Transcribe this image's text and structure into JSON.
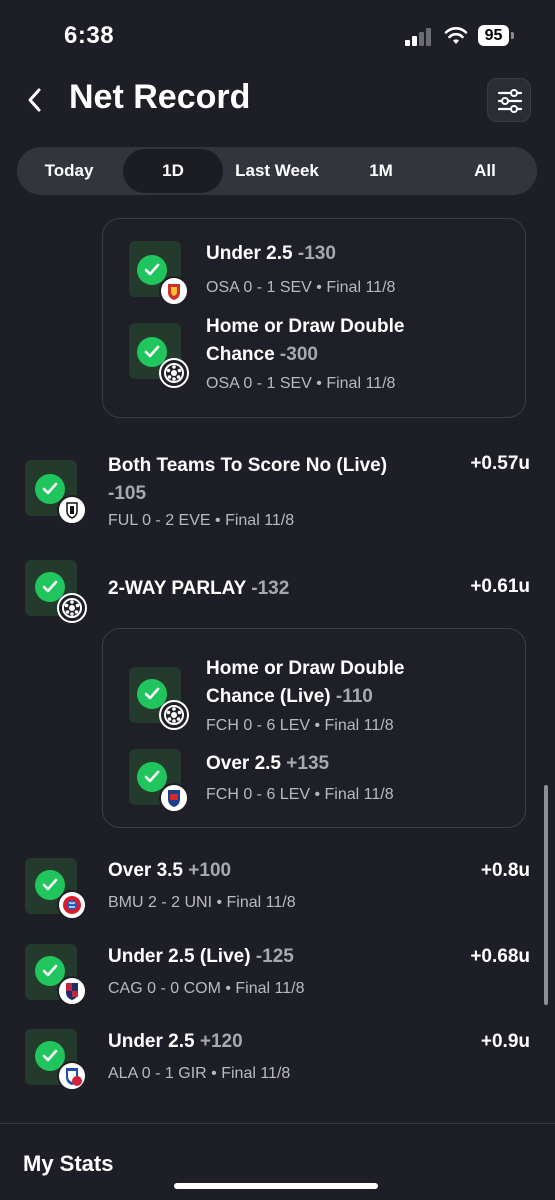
{
  "status_bar": {
    "time": "6:38",
    "battery": "95"
  },
  "header": {
    "title": "Net Record"
  },
  "tabs": [
    {
      "label": "Today",
      "active": false
    },
    {
      "label": "1D",
      "active": true
    },
    {
      "label": "Last Week",
      "active": false
    },
    {
      "label": "1M",
      "active": false
    },
    {
      "label": "All",
      "active": false
    }
  ],
  "parlay1_legs": [
    {
      "line1": "Under 2.5",
      "odds1": "-130",
      "score": "OSA 0 - 1 SEV",
      "status": "Final 11/8",
      "badge_icon": "sevilla-crest-icon"
    },
    {
      "line1": "Home or Draw Double",
      "line2": "Chance",
      "odds2": "-300",
      "score": "OSA 0 - 1 SEV",
      "status": "Final 11/8",
      "badge_icon": "soccer-ball-icon"
    }
  ],
  "bet_btts": {
    "line1": "Both Teams To Score No (Live)",
    "odds": "-105",
    "score": "FUL 0 - 2 EVE",
    "status": "Final 11/8",
    "amount": "+0.57u",
    "badge_icon": "fulham-crest-icon"
  },
  "bet_parlay": {
    "label": "2-WAY PARLAY",
    "odds": "-132",
    "amount": "+0.61u",
    "badge_icon": "soccer-ball-icon"
  },
  "parlay2_legs": [
    {
      "line1": "Home or Draw Double",
      "line2": "Chance (Live)",
      "odds2": "-110",
      "score": "FCH 0 - 6 LEV",
      "status": "Final 11/8",
      "badge_icon": "soccer-ball-icon"
    },
    {
      "line1": "Over 2.5",
      "odds1": "+135",
      "score": "FCH 0 - 6 LEV",
      "status": "Final 11/8",
      "badge_icon": "heidenheim-crest-icon"
    }
  ],
  "bets": [
    {
      "label": "Over 3.5",
      "odds": "+100",
      "score": "BMU 2 - 2 UNI",
      "status": "Final 11/8",
      "amount": "+0.8u",
      "badge_icon": "bayern-crest-icon"
    },
    {
      "label": "Under 2.5 (Live)",
      "odds": "-125",
      "score": "CAG 0 - 0 COM",
      "status": "Final 11/8",
      "amount": "+0.68u",
      "badge_icon": "cagliari-crest-icon"
    },
    {
      "label": "Under 2.5",
      "odds": "+120",
      "score": "ALA 0 - 1 GIR",
      "status": "Final 11/8",
      "amount": "+0.9u",
      "badge_icon": "alaves-crest-icon"
    }
  ],
  "section": {
    "my_stats": "My Stats"
  },
  "colors": {
    "background": "#1e1f26",
    "win_green": "#21c55d",
    "tab_bg": "#33353d",
    "card_border": "#3b3d46"
  }
}
